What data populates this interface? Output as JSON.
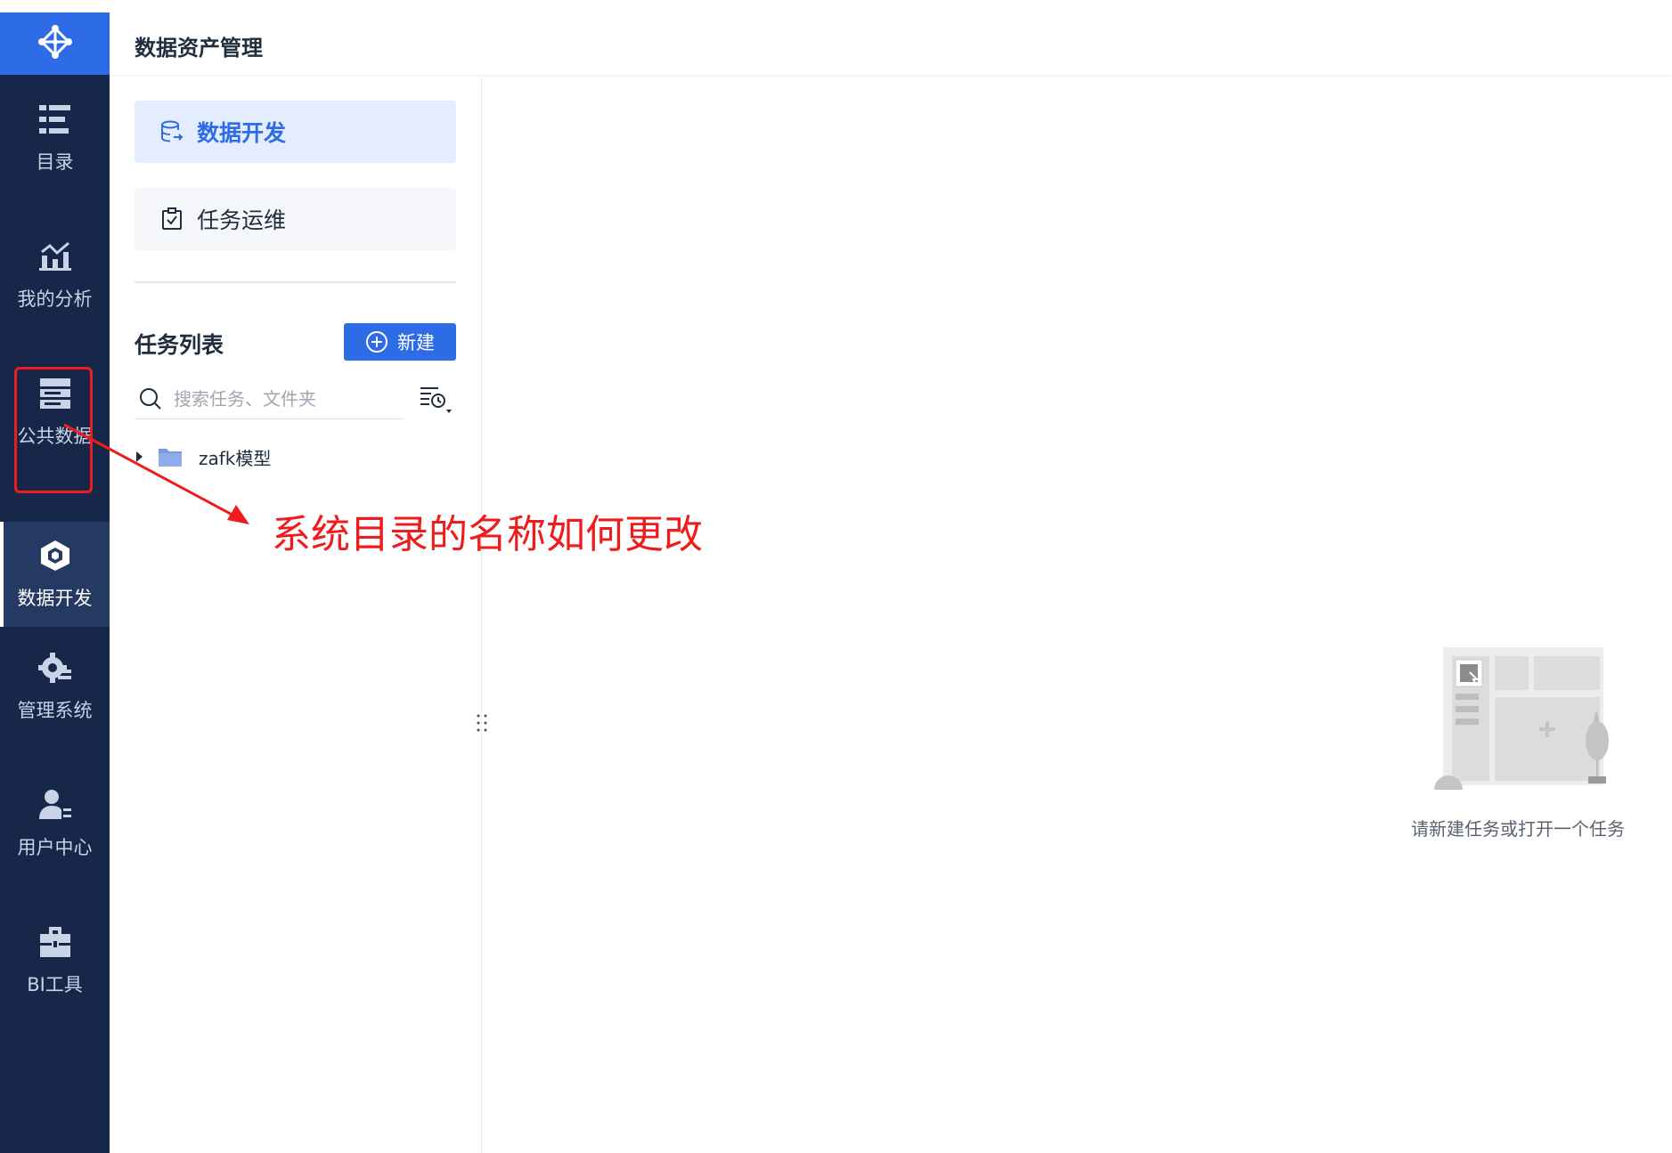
{
  "header": {
    "title": "数据资产管理"
  },
  "nav": {
    "items": [
      {
        "label": "目录",
        "icon": "catalog-icon"
      },
      {
        "label": "我的分析",
        "icon": "analysis-chart-icon"
      },
      {
        "label": "公共数据",
        "icon": "public-data-icon"
      },
      {
        "label": "数据开发",
        "icon": "data-dev-cube-icon",
        "active": true
      },
      {
        "label": "管理系统",
        "icon": "gear-admin-icon"
      },
      {
        "label": "用户中心",
        "icon": "user-icon"
      },
      {
        "label": "BI工具",
        "icon": "toolbox-icon"
      }
    ]
  },
  "panel": {
    "menu": [
      {
        "label": "数据开发",
        "icon": "database-icon",
        "active": true
      },
      {
        "label": "任务运维",
        "icon": "clipboard-check-icon"
      }
    ],
    "task_list_title": "任务列表",
    "new_button": "新建",
    "search_placeholder": "搜索任务、文件夹",
    "tree": [
      {
        "name": "zafk模型",
        "type": "folder"
      }
    ]
  },
  "main": {
    "empty_text": "请新建任务或打开一个任务"
  },
  "annotation": {
    "text": "系统目录的名称如何更改",
    "color": "#ee1c1c"
  },
  "colors": {
    "nav_bg": "#16274a",
    "accent": "#2e6be6",
    "annotation": "#ee1c1c"
  }
}
